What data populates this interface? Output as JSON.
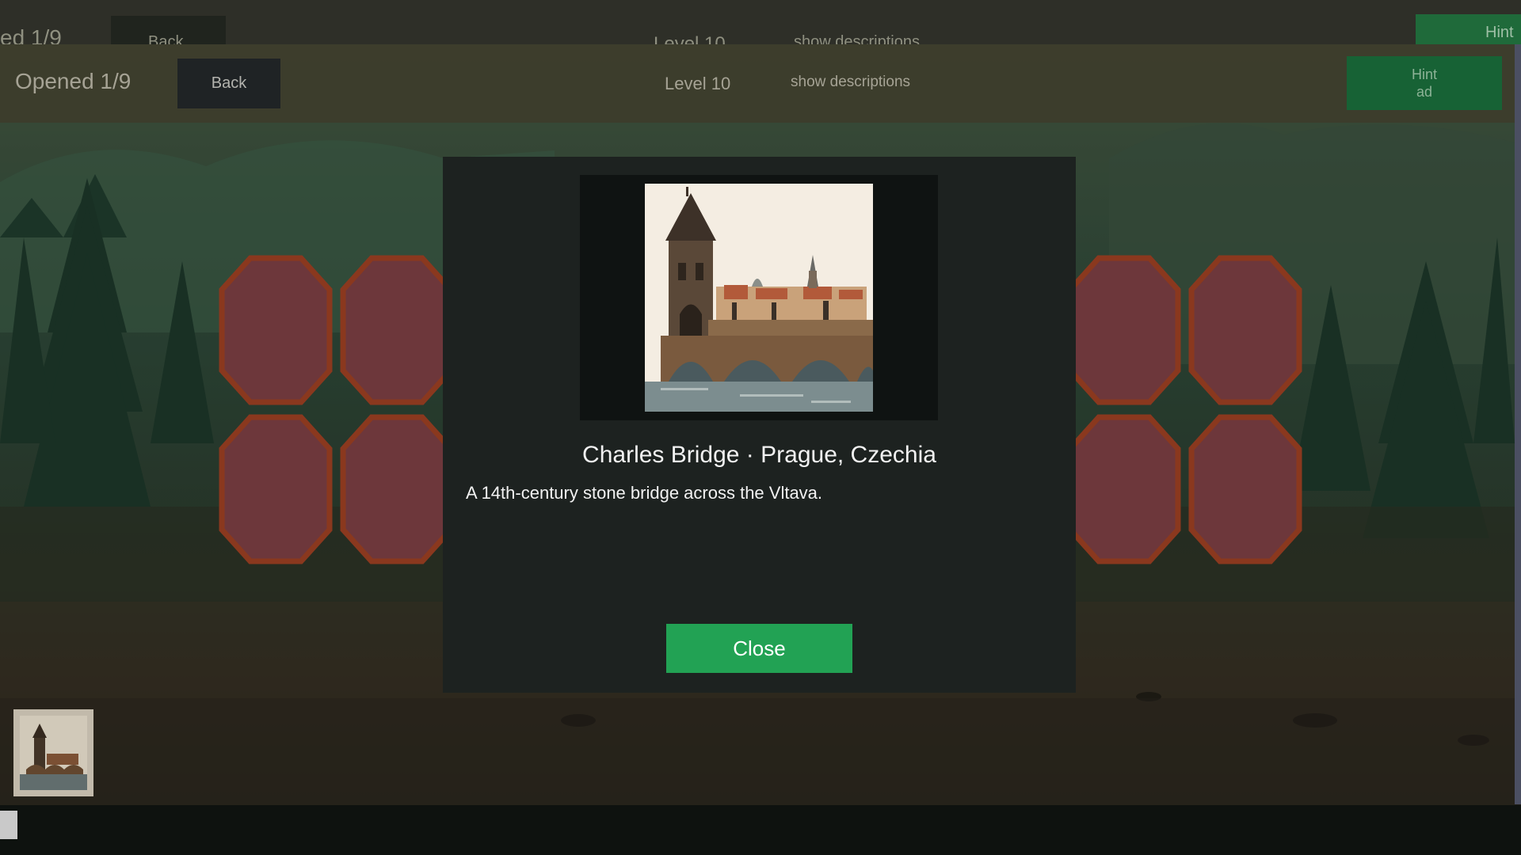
{
  "ghost_header": {
    "opened_text": "ed 1/9",
    "back_label": "Back",
    "level_text": "Level 10",
    "descriptions_text": "show descriptions",
    "hint_text": "Hint"
  },
  "header": {
    "opened_text": "Opened 1/9",
    "back_label": "Back",
    "level_text": "Level 10",
    "descriptions_toggle": "show descriptions",
    "hint_line1": "Hint",
    "hint_line2": "ad"
  },
  "board": {
    "rows": 2,
    "columns": 9,
    "tiles": [
      {
        "state": "closed"
      },
      {
        "state": "closed"
      },
      {
        "state": "empty"
      },
      {
        "state": "empty"
      },
      {
        "state": "empty"
      },
      {
        "state": "empty"
      },
      {
        "state": "empty"
      },
      {
        "state": "closed"
      },
      {
        "state": "closed"
      },
      {
        "state": "closed"
      },
      {
        "state": "closed"
      },
      {
        "state": "empty"
      },
      {
        "state": "empty"
      },
      {
        "state": "empty"
      },
      {
        "state": "empty"
      },
      {
        "state": "empty"
      },
      {
        "state": "closed"
      },
      {
        "state": "closed"
      }
    ],
    "colors": {
      "closed_fill": "#7a3e42",
      "closed_border": "#9a3f22",
      "empty_fill": "#2a2a28"
    }
  },
  "tray": {
    "items": [
      {
        "icon": "charles-bridge-thumbnail"
      }
    ]
  },
  "modal": {
    "image_icon": "charles-bridge-illustration",
    "title": "Charles Bridge · Prague, Czechia",
    "description": "A 14th-century stone bridge across the Vltava.",
    "close_label": "Close"
  },
  "colors": {
    "accent_green": "#22a254",
    "hint_green": "#1a6e3c",
    "header_bg": "#444432",
    "modal_bg": "#1d2220"
  }
}
